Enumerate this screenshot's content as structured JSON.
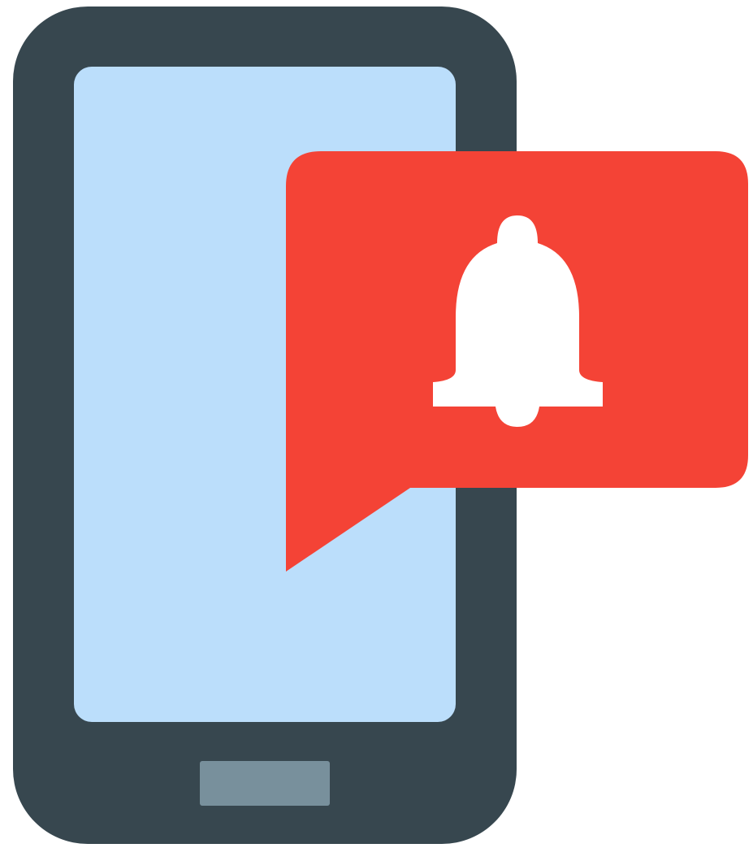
{
  "illustration": {
    "icon_names": [
      "smartphone-icon",
      "notification-bubble-icon",
      "bell-icon"
    ],
    "colors": {
      "phone_body": "#37474F",
      "phone_screen": "#BBDEFB",
      "home_button": "#78909C",
      "bubble": "#F44336",
      "bell": "#FFFFFF",
      "background": "#FFFFFF"
    }
  }
}
